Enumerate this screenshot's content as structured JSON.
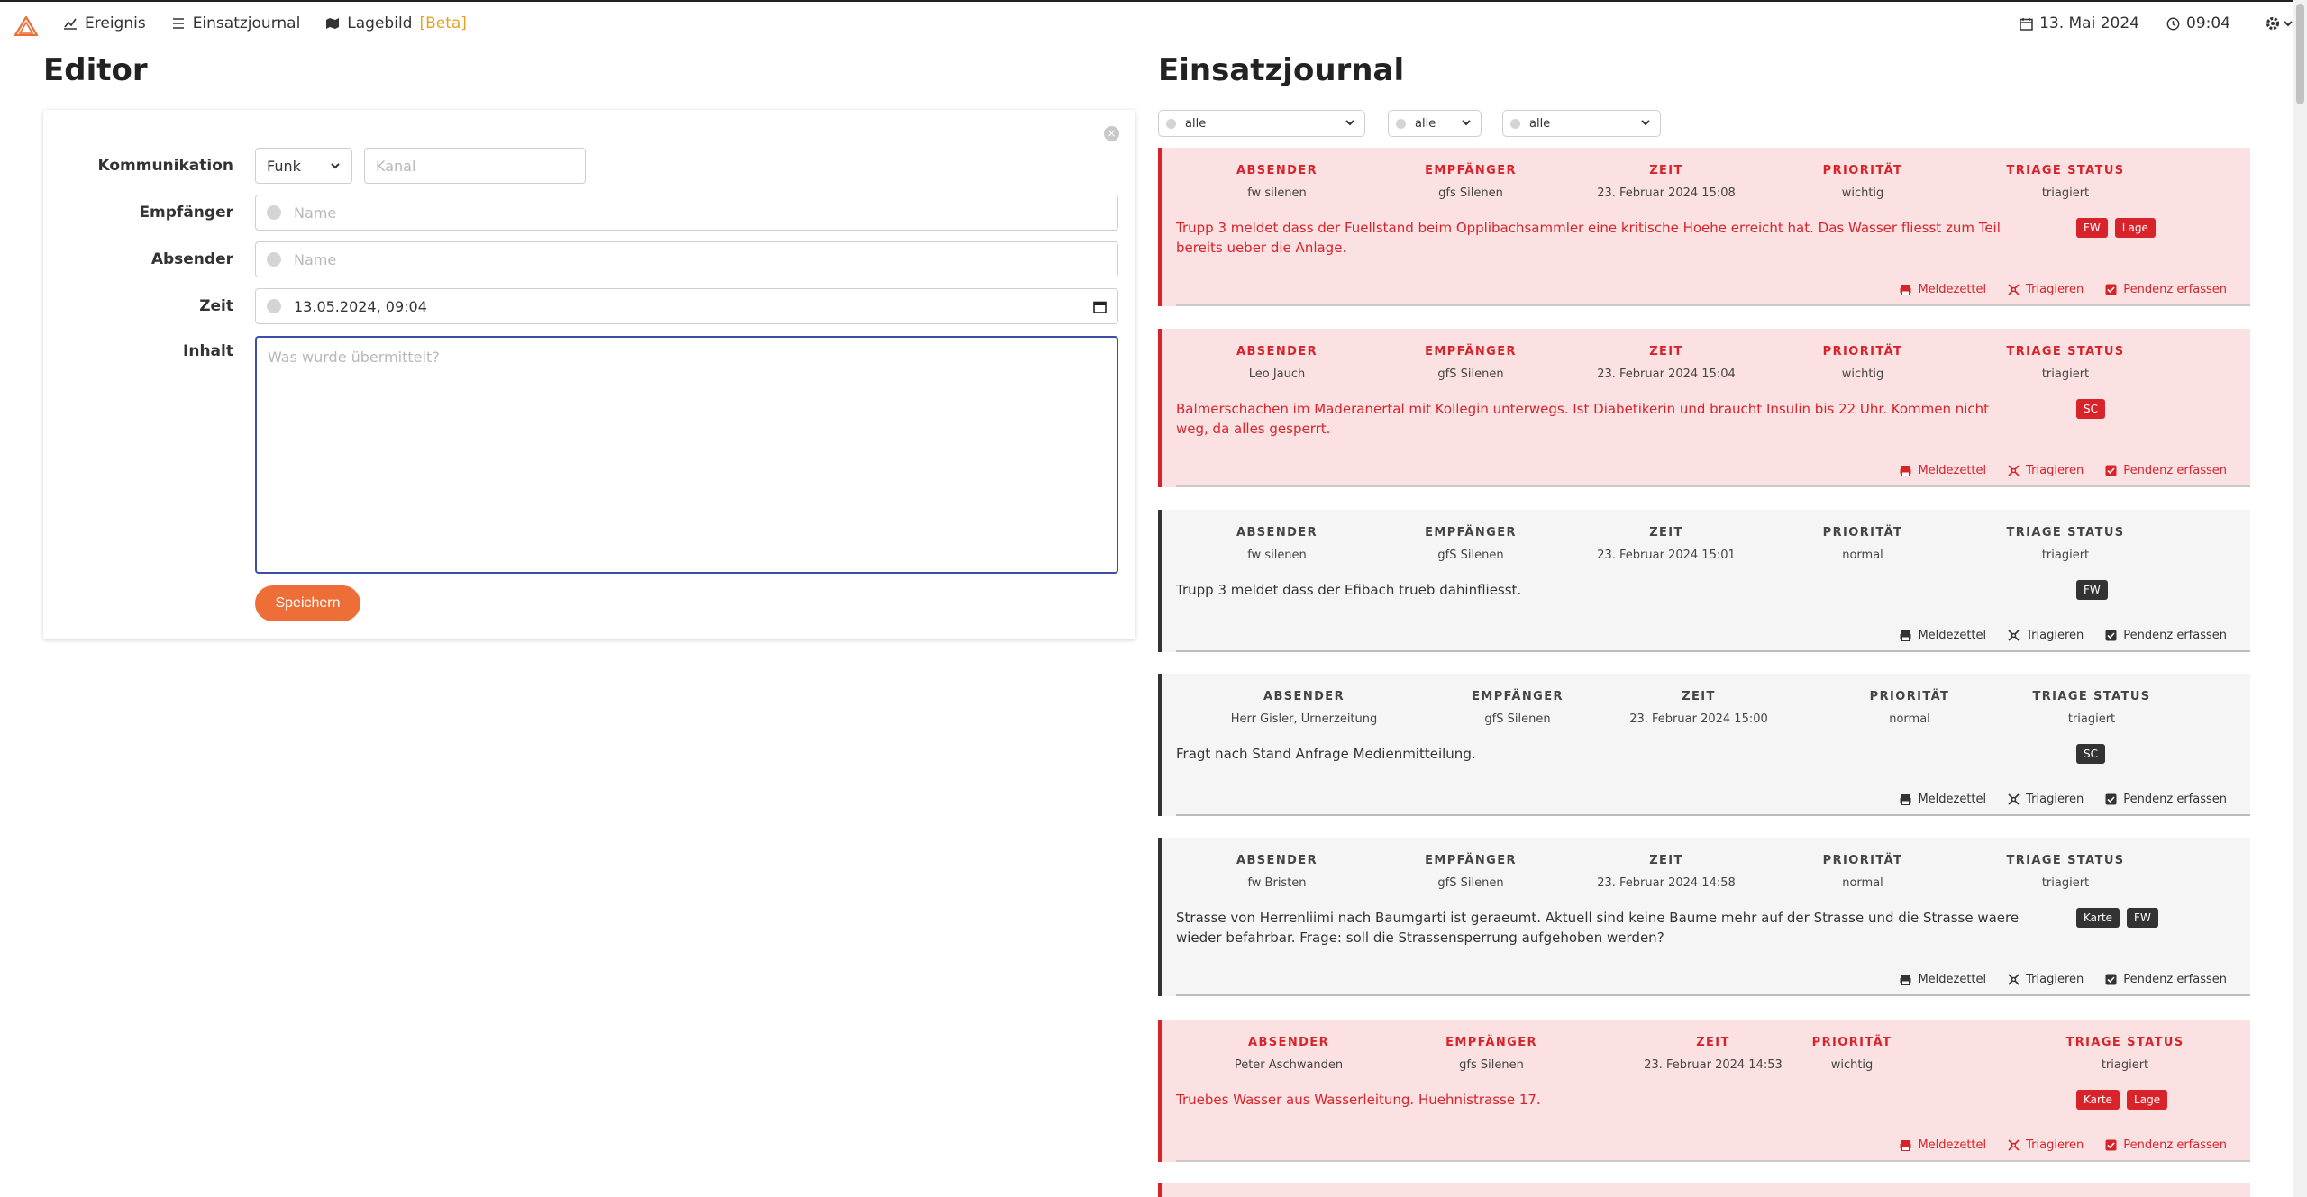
{
  "nav": {
    "items": [
      {
        "label": "Ereignis",
        "icon": "chart-line-icon"
      },
      {
        "label": "Einsatzjournal",
        "icon": "list-icon"
      },
      {
        "label": "Lagebild",
        "icon": "map-icon",
        "badge": "[Beta]"
      }
    ],
    "date": "13. Mai 2024",
    "time": "09:04"
  },
  "editor": {
    "title": "Editor",
    "kommunikation_label": "Kommunikation",
    "kommunikation_value": "Funk",
    "kanal_placeholder": "Kanal",
    "empfaenger_label": "Empfänger",
    "empfaenger_placeholder": "Name",
    "absender_label": "Absender",
    "absender_placeholder": "Name",
    "zeit_label": "Zeit",
    "zeit_value": "13.05.2024, 09:04",
    "inhalt_label": "Inhalt",
    "inhalt_placeholder": "Was wurde übermittelt?",
    "save_label": "Speichern"
  },
  "journal": {
    "title": "Einsatzjournal",
    "filters": [
      "alle",
      "alle",
      "alle"
    ],
    "headers": {
      "absender": "ABSENDER",
      "empfaenger": "EMPFÄNGER",
      "zeit": "ZEIT",
      "prioritaet": "PRIORITÄT",
      "triage": "TRIAGE STATUS"
    },
    "actions": {
      "meldezettel": "Meldezettel",
      "triagieren": "Triagieren",
      "pendenz": "Pendenz erfassen"
    },
    "entries": [
      {
        "absender": "fw silenen",
        "empfaenger": "gfs Silenen",
        "zeit": "23. Februar 2024 15:08",
        "prioritaet": "wichtig",
        "triage": "triagiert",
        "message": "Trupp 3 meldet dass der Fuellstand beim Opplibachsammler eine kritische Hoehe erreicht hat. Das Wasser fliesst zum Teil bereits ueber die Anlage.",
        "tags": [
          "FW",
          "Lage"
        ]
      },
      {
        "absender": "Leo Jauch",
        "empfaenger": "gfS Silenen",
        "zeit": "23. Februar 2024 15:04",
        "prioritaet": "wichtig",
        "triage": "triagiert",
        "message": "Balmerschachen im Maderanertal mit Kollegin unterwegs. Ist Diabetikerin und braucht Insulin bis 22 Uhr. Kommen nicht weg, da alles gesperrt.",
        "tags": [
          "SC"
        ]
      },
      {
        "absender": "fw silenen",
        "empfaenger": "gfS Silenen",
        "zeit": "23. Februar 2024 15:01",
        "prioritaet": "normal",
        "triage": "triagiert",
        "message": "Trupp 3 meldet dass der Efibach trueb dahinfliesst.",
        "tags": [
          "FW"
        ]
      },
      {
        "absender": "Herr Gisler, Urnerzeitung",
        "empfaenger": "gfS Silenen",
        "zeit": "23. Februar 2024 15:00",
        "prioritaet": "normal",
        "triage": "triagiert",
        "message": "Fragt nach Stand Anfrage Medienmitteilung.",
        "tags": [
          "SC"
        ]
      },
      {
        "absender": "fw Bristen",
        "empfaenger": "gfS Silenen",
        "zeit": "23. Februar 2024 14:58",
        "prioritaet": "normal",
        "triage": "triagiert",
        "message": "Strasse von Herrenliimi nach Baumgarti ist geraeumt. Aktuell sind keine Baume mehr auf der Strasse und die Strasse waere wieder befahrbar. Frage: soll die Strassensperrung aufgehoben werden?",
        "tags": [
          "Karte",
          "FW"
        ]
      },
      {
        "absender": "Peter Aschwanden",
        "empfaenger": "gfs Silenen",
        "zeit": "23. Februar 2024 14:53",
        "prioritaet": "wichtig",
        "triage": "triagiert",
        "message": "Truebes Wasser aus Wasserleitung. Huehnistrasse 17.",
        "tags": [
          "Karte",
          "Lage"
        ]
      }
    ]
  }
}
